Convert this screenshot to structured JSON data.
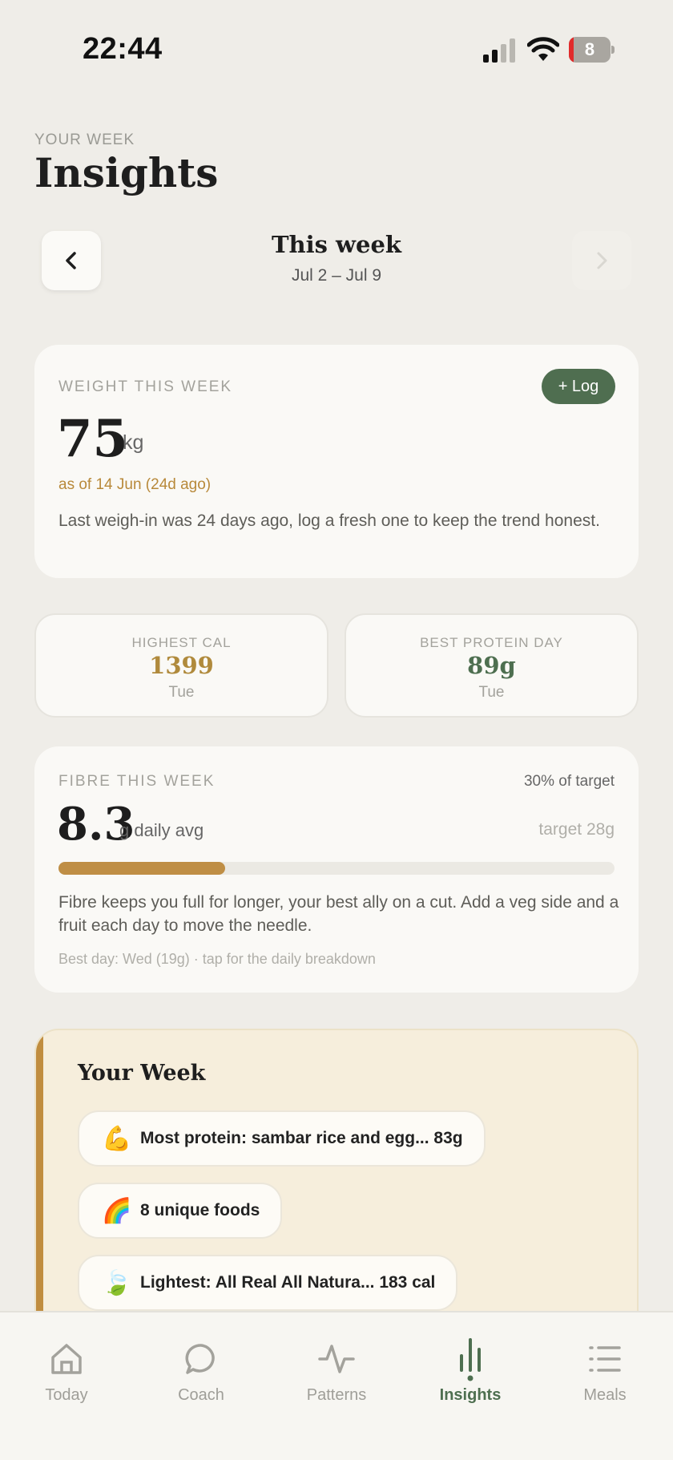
{
  "status_bar": {
    "time": "22:44",
    "battery": "8"
  },
  "header": {
    "eyebrow": "YOUR WEEK",
    "title": "Insights"
  },
  "week_nav": {
    "title": "This week",
    "range": "Jul 2 – Jul 9",
    "prev_icon": "chevron-left-icon",
    "next_icon": "chevron-right-icon"
  },
  "weight": {
    "label": "WEIGHT THIS WEEK",
    "log_button": "+ Log",
    "value": "75",
    "unit": "kg",
    "as_of": "as of 14 Jun (24d ago)",
    "note": "Last weigh-in was 24 days ago, log a fresh one to keep the trend honest."
  },
  "stats": {
    "highest_cal": {
      "label": "HIGHEST CAL",
      "value": "1399",
      "day": "Tue",
      "color": "#b08a3c"
    },
    "best_protein": {
      "label": "BEST PROTEIN DAY",
      "value": "89g",
      "day": "Tue",
      "color": "#4e6f50"
    }
  },
  "fibre": {
    "label": "FIBRE THIS WEEK",
    "percent_text": "30% of target",
    "value": "8.3",
    "unit": "g daily avg",
    "target": "target 28g",
    "progress": 0.3,
    "note": "Fibre keeps you full for longer, your best ally on a cut. Add a veg side and a fruit each day to move the needle.",
    "best": "Best day: Wed (19g) · tap for the daily breakdown"
  },
  "your_week": {
    "heading": "Your Week",
    "items": [
      {
        "emoji": "💪",
        "text": "Most protein: sambar rice and egg... 83g"
      },
      {
        "emoji": "🌈",
        "text": "8 unique foods"
      },
      {
        "emoji": "🍃",
        "text": "Lightest: All Real All Natura... 183 cal"
      }
    ]
  },
  "tabs": [
    {
      "label": "Today",
      "icon": "home-icon",
      "active": false
    },
    {
      "label": "Coach",
      "icon": "chat-bubble-icon",
      "active": false
    },
    {
      "label": "Patterns",
      "icon": "pulse-icon",
      "active": false
    },
    {
      "label": "Insights",
      "icon": "bar-chart-icon",
      "active": true
    },
    {
      "label": "Meals",
      "icon": "list-icon",
      "active": false
    }
  ],
  "colors": {
    "accent": "#4e6f50",
    "gold": "#bf8e45",
    "background": "#efede8"
  }
}
